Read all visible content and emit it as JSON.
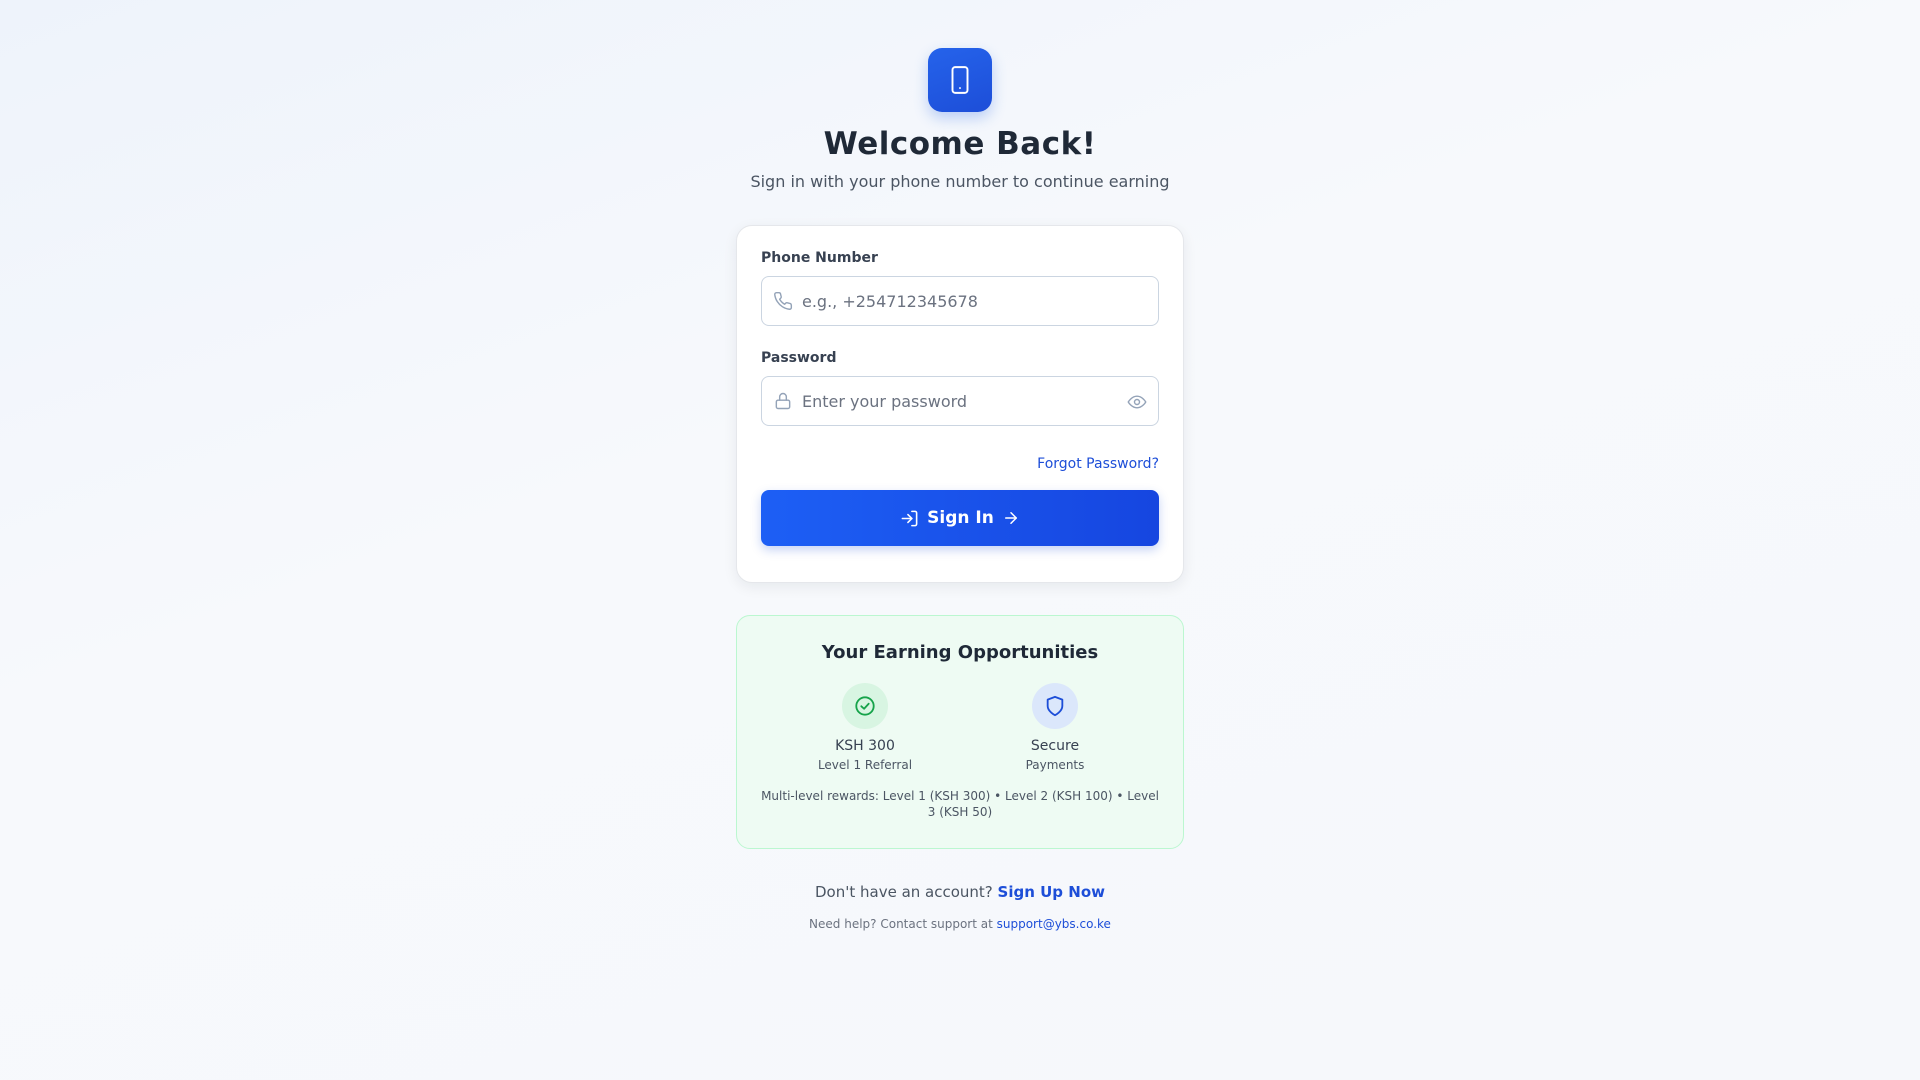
{
  "header": {
    "logo_icon": "smartphone-icon",
    "title": "Welcome Back!",
    "subtitle": "Sign in with your phone number to continue earning"
  },
  "form": {
    "phone_label": "Phone Number",
    "phone_placeholder": "e.g., +254712345678",
    "phone_value": "",
    "phone_icon": "phone-icon",
    "password_label": "Password",
    "password_placeholder": "Enter your password",
    "password_value": "",
    "password_icon": "lock-icon",
    "toggle_icon": "eye-icon",
    "forgot_label": "Forgot Password?",
    "submit_label": "Sign In"
  },
  "earnings": {
    "title": "Your Earning Opportunities",
    "items": [
      {
        "icon": "check-circle-icon",
        "main": "KSH 300",
        "sub": "Level 1 Referral",
        "color": "#16a34a"
      },
      {
        "icon": "shield-icon",
        "main": "Secure",
        "sub": "Payments",
        "color": "#1d4ed8"
      }
    ],
    "note": "Multi-level rewards: Level 1 (KSH 300) • Level 2 (KSH 100) • Level 3 (KSH 50)"
  },
  "footer": {
    "signup_prompt": "Don't have an account?",
    "signup_link": "Sign Up Now",
    "help_prompt": "Need help? Contact support at",
    "help_email": "support@ybs.co.ke"
  },
  "colors": {
    "primary": "#1d4ed8",
    "success": "#16a34a",
    "background": "#f5f7fb"
  }
}
